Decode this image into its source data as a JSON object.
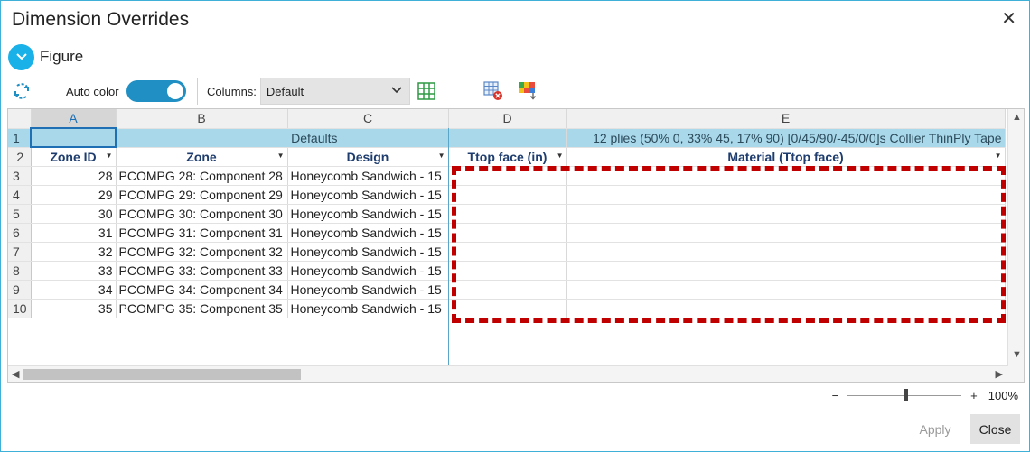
{
  "window": {
    "title": "Dimension Overrides"
  },
  "figure": {
    "label": "Figure"
  },
  "toolbar": {
    "auto_color_label": "Auto color",
    "columns_label": "Columns:",
    "columns_value": "Default"
  },
  "grid": {
    "column_letters": [
      "A",
      "B",
      "C",
      "D",
      "E"
    ],
    "defaults_label": "Defaults",
    "defaults_e": "12 plies (50% 0, 33% 45, 17% 90) [0/45/90/-45/0/0]s Collier ThinPly Tape",
    "headers": [
      "Zone ID",
      "Zone",
      "Design",
      "Ttop face (in)",
      "Material (Ttop face)"
    ],
    "row_numbers": [
      "1",
      "2",
      "3",
      "4",
      "5",
      "6",
      "7",
      "8",
      "9",
      "10"
    ],
    "rows": [
      {
        "id": "28",
        "zone": "PCOMPG 28: Component 28",
        "design": "Honeycomb Sandwich - 15"
      },
      {
        "id": "29",
        "zone": "PCOMPG 29: Component 29",
        "design": "Honeycomb Sandwich - 15"
      },
      {
        "id": "30",
        "zone": "PCOMPG 30: Component 30",
        "design": "Honeycomb Sandwich - 15"
      },
      {
        "id": "31",
        "zone": "PCOMPG 31: Component 31",
        "design": "Honeycomb Sandwich - 15"
      },
      {
        "id": "32",
        "zone": "PCOMPG 32: Component 32",
        "design": "Honeycomb Sandwich - 15"
      },
      {
        "id": "33",
        "zone": "PCOMPG 33: Component 33",
        "design": "Honeycomb Sandwich - 15"
      },
      {
        "id": "34",
        "zone": "PCOMPG 34: Component 34",
        "design": "Honeycomb Sandwich - 15"
      },
      {
        "id": "35",
        "zone": "PCOMPG 35: Component 35",
        "design": "Honeycomb Sandwich - 15"
      }
    ]
  },
  "zoom": {
    "minus": "−",
    "plus": "+",
    "value": "100%",
    "level_percent": 100
  },
  "buttons": {
    "apply": "Apply",
    "close": "Close"
  },
  "colors": {
    "accent": "#1ab0e8",
    "toggle_on": "#1f8fc4",
    "defaults_row": "#a9d8ea",
    "header_text": "#1e3d6e",
    "highlight_border": "#c00000"
  }
}
